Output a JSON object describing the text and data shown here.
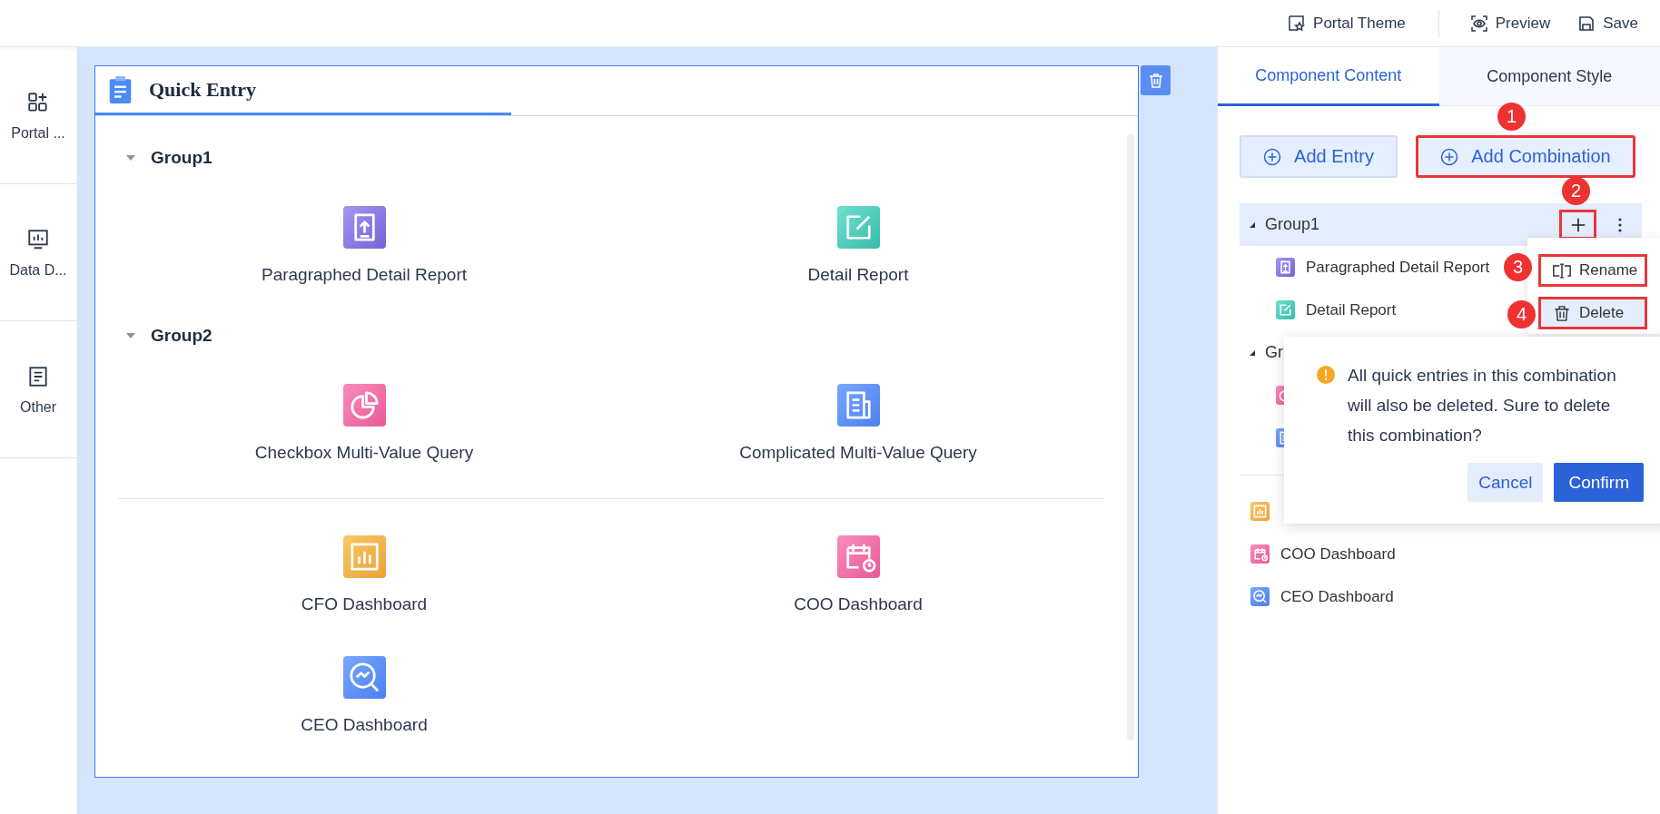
{
  "toolbar": [
    {
      "kind": "theme",
      "label": "Portal Theme"
    },
    {
      "kind": "preview",
      "label": "Preview"
    },
    {
      "kind": "save",
      "label": "Save"
    }
  ],
  "sidebar": {
    "items": [
      {
        "kind": "grid-plus",
        "label": "Portal ..."
      },
      {
        "kind": "monitor-chart",
        "label": "Data D..."
      },
      {
        "kind": "document",
        "label": "Other"
      }
    ]
  },
  "card": {
    "title": "Quick Entry",
    "groups": [
      {
        "name": "Group1",
        "expanded": true,
        "entries": [
          {
            "kind": "upload",
            "label": "Paragraphed Detail Report"
          },
          {
            "kind": "edit",
            "label": "Detail Report"
          }
        ]
      },
      {
        "name": "Group2",
        "expanded": true,
        "entries": [
          {
            "kind": "pie",
            "label": "Checkbox Multi-Value Query"
          },
          {
            "kind": "report",
            "label": "Complicated Multi-Value Query"
          }
        ]
      }
    ],
    "ungrouped": [
      {
        "kind": "bar",
        "label": "CFO Dashboard"
      },
      {
        "kind": "calendar",
        "label": "COO Dashboard"
      },
      {
        "kind": "search-chart",
        "label": "CEO Dashboard"
      }
    ]
  },
  "panel": {
    "tabs": [
      {
        "label": "Component Content",
        "selected": true
      },
      {
        "label": "Component Style",
        "selected": false
      }
    ],
    "buttons": [
      {
        "label": "Add Entry",
        "highlighted": false
      },
      {
        "label": "Add Combination",
        "highlighted": true
      }
    ],
    "row_actions": {
      "highlighted": true
    },
    "tree": [
      {
        "label": "Group1",
        "expanded": true,
        "selected": true,
        "children": [
          {
            "kind": "upload",
            "label": "Paragraphed Detail Report"
          },
          {
            "kind": "edit",
            "label": "Detail Report"
          }
        ]
      },
      {
        "label": "Gr",
        "expanded": true,
        "selected": false,
        "children": [
          {
            "kind": "pie"
          },
          {
            "kind": "report"
          }
        ]
      }
    ],
    "ungrouped": [
      {
        "kind": "bar"
      },
      {
        "kind": "calendar",
        "label": "COO Dashboard"
      },
      {
        "kind": "search-chart",
        "label": "CEO Dashboard"
      }
    ],
    "menu": [
      {
        "kind": "rename",
        "label": "Rename",
        "highlighted": true,
        "hovered": false
      },
      {
        "kind": "trash",
        "label": "Delete",
        "highlighted": true,
        "hovered": true
      }
    ],
    "confirm": {
      "message": "All quick entries in this combination will also be deleted. Sure to delete this combination?",
      "cancel": "Cancel",
      "confirm": "Confirm"
    },
    "steps": [
      "1",
      "2",
      "3",
      "4"
    ]
  }
}
